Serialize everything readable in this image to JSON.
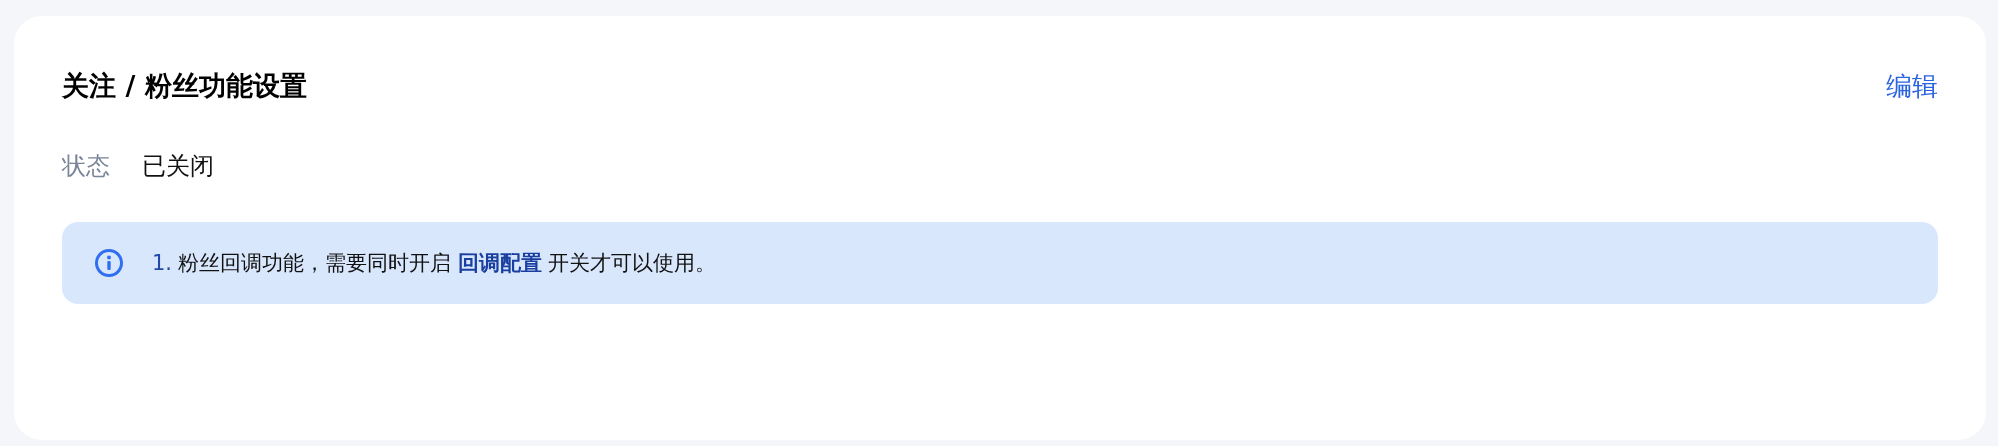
{
  "card": {
    "title": "关注 / 粉丝功能设置",
    "edit_link": "编辑",
    "fields": [
      {
        "label": "状态",
        "value": "已关闭"
      }
    ],
    "notice": {
      "items": [
        {
          "number": "1.",
          "text_before": "粉丝回调功能，需要同时开启",
          "link": "回调配置",
          "text_after": "开关才可以使用。"
        }
      ]
    }
  }
}
